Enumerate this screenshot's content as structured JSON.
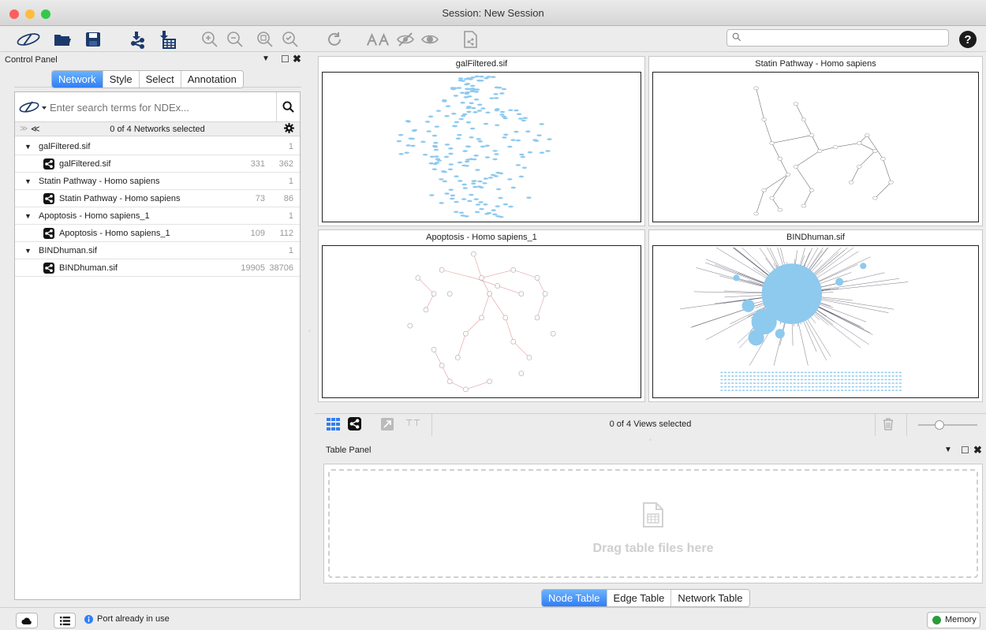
{
  "window": {
    "title": "Session: New Session"
  },
  "toolbar": {
    "icons": [
      "cytoscape-logo-icon",
      "open-folder-icon",
      "save-icon",
      "import-network-icon",
      "import-table-icon",
      "zoom-in-icon",
      "zoom-out-icon",
      "zoom-fit-icon",
      "zoom-selected-icon",
      "refresh-icon",
      "show-all-icon",
      "hide-icon",
      "show-icon",
      "export-icon",
      "help-icon"
    ],
    "search_value": ""
  },
  "control_panel": {
    "title": "Control Panel",
    "tabs": [
      "Network",
      "Style",
      "Select",
      "Annotation"
    ],
    "selected_tab": "Network",
    "ndex_placeholder": "Enter search terms for NDEx...",
    "summary": "0 of 4 Networks selected",
    "networks": [
      {
        "collection": "galFiltered.sif",
        "count": "1",
        "name": "galFiltered.sif",
        "nodes": "331",
        "edges": "362"
      },
      {
        "collection": "Statin Pathway - Homo sapiens",
        "count": "1",
        "name": "Statin Pathway - Homo sapiens",
        "nodes": "73",
        "edges": "86"
      },
      {
        "collection": "Apoptosis - Homo sapiens_1",
        "count": "1",
        "name": "Apoptosis - Homo sapiens_1",
        "nodes": "109",
        "edges": "112"
      },
      {
        "collection": "BINDhuman.sif",
        "count": "1",
        "name": "BINDhuman.sif",
        "nodes": "19905",
        "edges": "38706"
      }
    ]
  },
  "views": {
    "titles": [
      "galFiltered.sif",
      "Statin Pathway - Homo sapiens",
      "Apoptosis - Homo sapiens_1",
      "BINDhuman.sif"
    ],
    "summary": "0 of 4 Views selected"
  },
  "table_panel": {
    "title": "Table Panel",
    "drop_text": "Drag table files here",
    "tabs": [
      "Node Table",
      "Edge Table",
      "Network Table"
    ],
    "selected_tab": "Node Table"
  },
  "status": {
    "message": "Port already in use",
    "memory": "Memory"
  },
  "colors": {
    "accent": "#2f7ef6",
    "node_blue": "#8ec9ee",
    "memory_green": "#2a9d3a"
  }
}
